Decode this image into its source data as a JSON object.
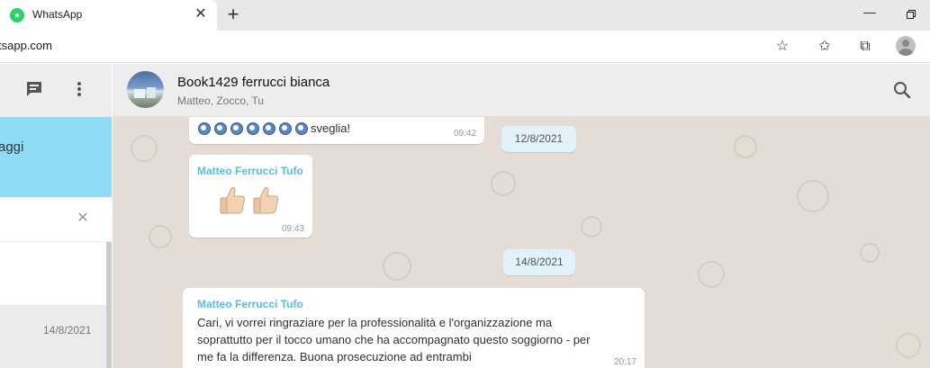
{
  "browser": {
    "tab_title": "WhatsApp",
    "tab_close": "✕",
    "new_tab": "+",
    "url": "tsapp.com",
    "icons": [
      "favorite-add-icon",
      "favorites-icon",
      "collections-icon",
      "profile-icon"
    ]
  },
  "sidebar": {
    "notification_text": "aggi",
    "search_clear": "✕",
    "selected_chat_date": "14/8/2021"
  },
  "chat": {
    "title": "Book1429 ferrucci bianca",
    "members": "Matteo, Zocco, Tu",
    "messages": [
      {
        "text": "sveglia!",
        "alarm_emoji_count": 7,
        "time": "09:42"
      },
      {
        "sender": "Matteo Ferrucci Tufo",
        "emoji": "thumbs-up x2",
        "time": "09:43"
      },
      {
        "sender": "Matteo Ferrucci Tufo",
        "lines": [
          "Cari, vi vorrei ringraziare per la professionalità e l'organizzazione ma",
          "soprattutto per il tocco umano che ha accompagnato questo soggiorno - per",
          "me fa la differenza. Buona prosecuzione ad entrambi"
        ],
        "time": "20:17"
      }
    ],
    "date_separators": [
      "12/8/2021",
      "14/8/2021"
    ]
  },
  "colors": {
    "chat_background": "#e5ddd5",
    "sender_name": "#53bdeb",
    "notification_banner": "#8fdcf6",
    "date_pill": "#e1f2fa"
  }
}
